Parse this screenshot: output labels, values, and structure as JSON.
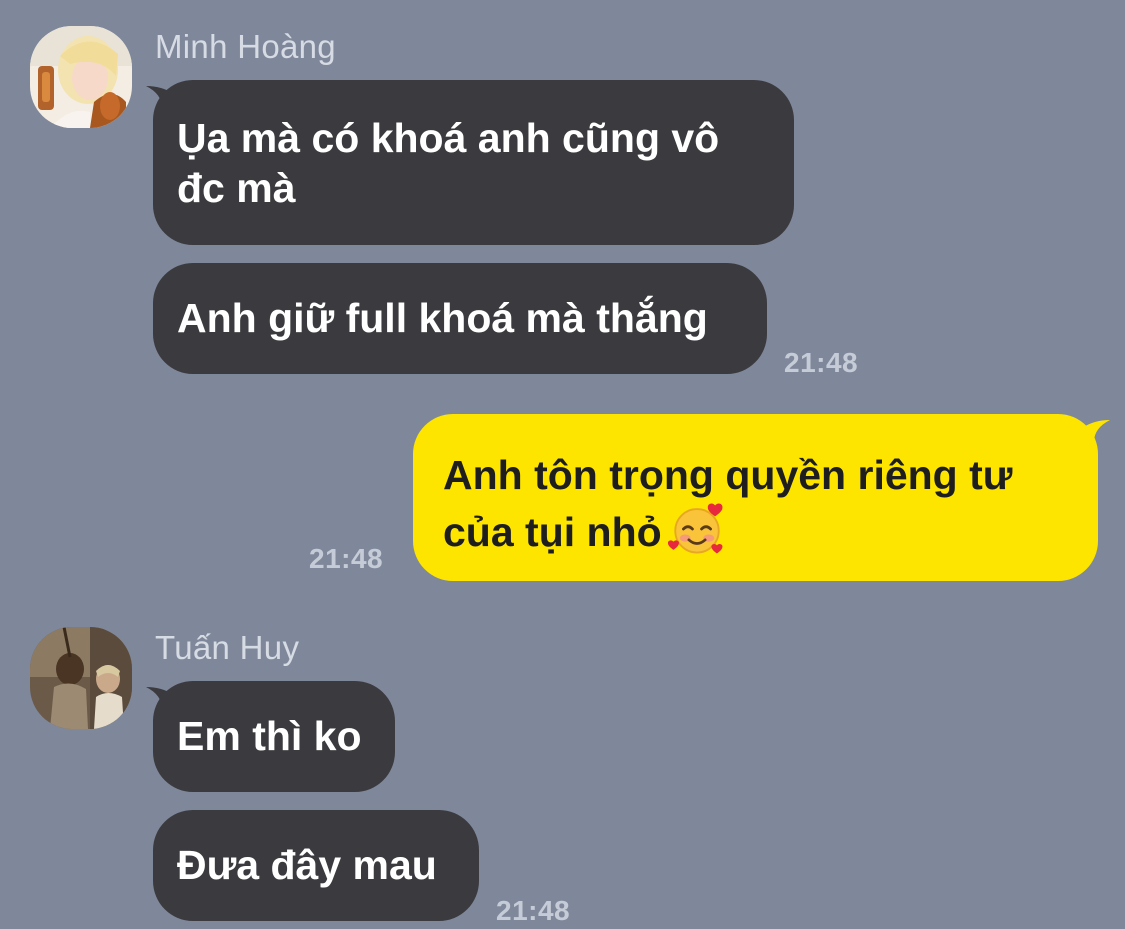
{
  "conversation": [
    {
      "sender": "Minh Hoàng",
      "avatar_icon": "user-photo-blonde",
      "messages": [
        {
          "lines": [
            "Ụa mà có khoá anh cũng vô",
            "đc mà"
          ]
        },
        {
          "lines": [
            "Anh giữ full khoá mà thắng"
          ]
        }
      ],
      "time": "21:48"
    },
    {
      "outgoing": true,
      "messages": [
        {
          "lines": [
            "Anh tôn trọng quyền riêng tư",
            "của tụi nhỏ"
          ],
          "emoji": "smiling-face-with-hearts"
        }
      ],
      "time": "21:48"
    },
    {
      "sender": "Tuấn Huy",
      "avatar_icon": "user-photo-two-people",
      "messages": [
        {
          "lines": [
            "Em thì ko"
          ]
        },
        {
          "lines": [
            "Đưa đây mau"
          ]
        }
      ],
      "time": "21:48"
    }
  ],
  "colors": {
    "background": "#7f889b",
    "incoming_bubble": "#3b3b3f",
    "outgoing_bubble": "#fee500",
    "sender_name": "#d6dbe4",
    "timestamp": "#c6ccd7"
  }
}
